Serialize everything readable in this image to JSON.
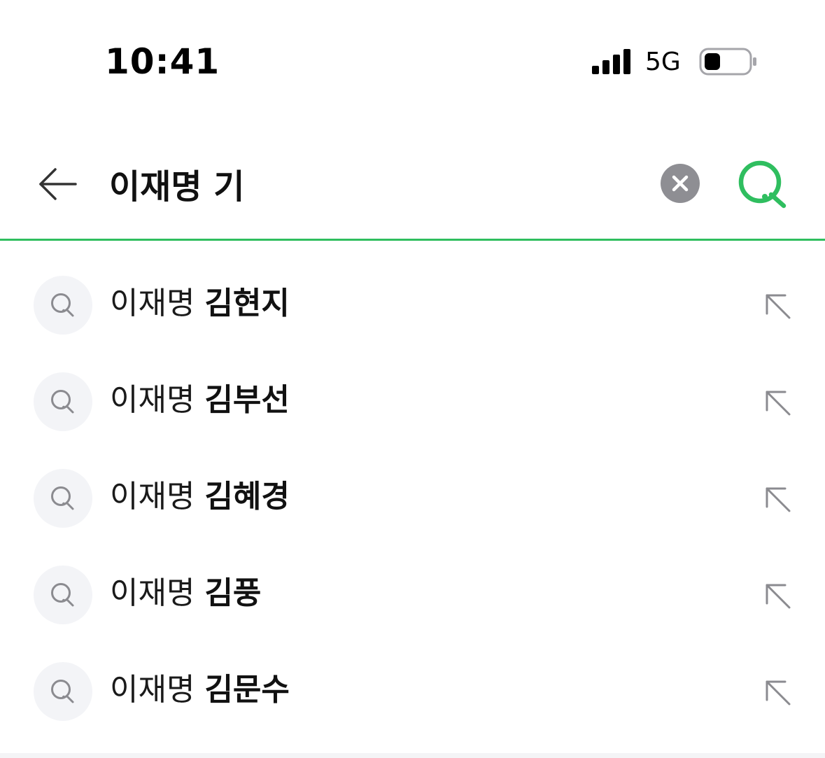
{
  "status_bar": {
    "time": "10:41",
    "network": "5G",
    "icons": [
      "signal-bars-icon",
      "battery-icon"
    ]
  },
  "search": {
    "query": "이재명 기",
    "back_icon": "arrow-left-icon",
    "clear_icon": "clear-x-icon",
    "submit_icon": "search-icon",
    "accent_color": "#2fbe5f"
  },
  "suggestions": [
    {
      "prefix": "이재명 ",
      "completion": "김현지"
    },
    {
      "prefix": "이재명 ",
      "completion": "김부선"
    },
    {
      "prefix": "이재명 ",
      "completion": "김혜경"
    },
    {
      "prefix": "이재명 ",
      "completion": "김풍"
    },
    {
      "prefix": "이재명 ",
      "completion": "김문수"
    }
  ],
  "suggestion_icons": {
    "leading": "search-icon",
    "trailing": "arrow-up-left-icon"
  }
}
